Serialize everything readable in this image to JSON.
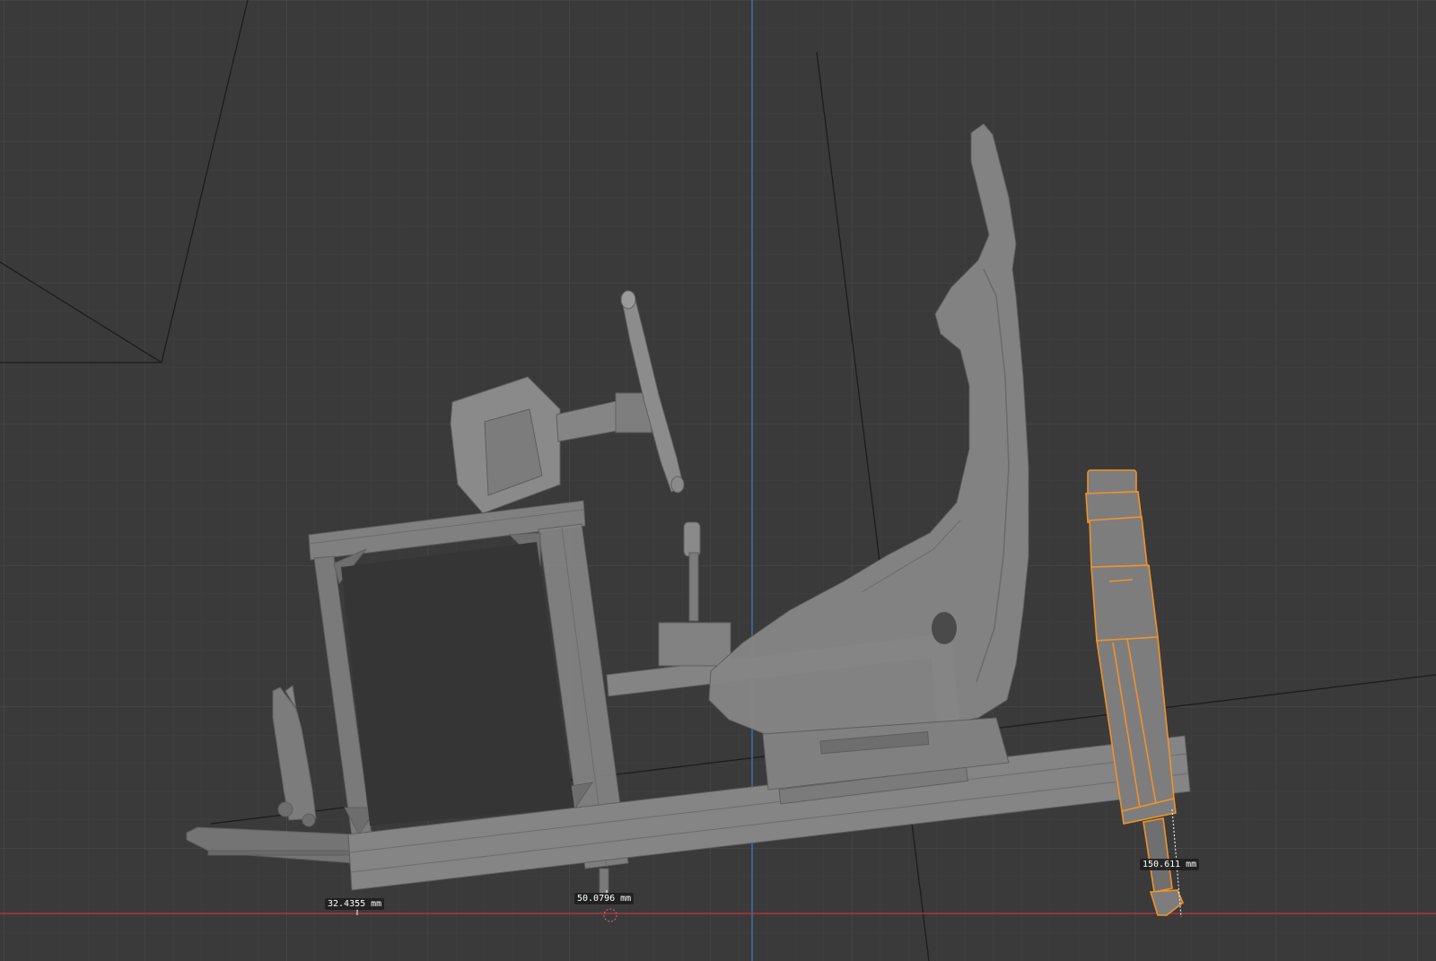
{
  "viewport": {
    "background": "#3a3a3a",
    "grid_minor": "#424242",
    "grid_major": "#4a4a4a",
    "x_axis_color": "#c8343a",
    "y_axis_color": "#3d78b8",
    "model_color": "#7a7a7a",
    "selected_outline": "#f0922a"
  },
  "measurements": [
    {
      "id": "left",
      "text": "32.4355 mm"
    },
    {
      "id": "center",
      "text": "50.0796 mm"
    },
    {
      "id": "right",
      "text": "150.611 mm"
    }
  ],
  "selected_object": "damper-actuator",
  "scene_objects": [
    "pedal",
    "frame",
    "wheel-base",
    "steering-wheel",
    "shifter",
    "seat",
    "actuator"
  ]
}
